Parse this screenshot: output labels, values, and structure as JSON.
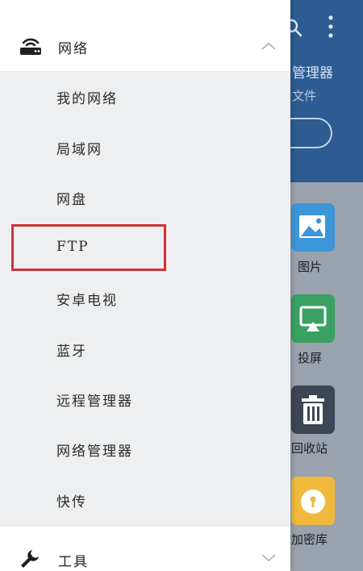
{
  "background": {
    "title": "管理器",
    "subtitle": "文件",
    "tiles": [
      {
        "label": "图片",
        "color": "#3d96d8",
        "icon": "image-icon"
      },
      {
        "label": "投屏",
        "color": "#3aa163",
        "icon": "cast-icon"
      },
      {
        "label": "回收站",
        "color": "#3d4656",
        "icon": "trash-icon"
      },
      {
        "label": "加密库",
        "color": "#f0b93b",
        "icon": "lock-icon"
      }
    ]
  },
  "drawer": {
    "network": {
      "label": "网络",
      "icon": "router-icon",
      "expanded": true
    },
    "items": [
      {
        "label": "我的网络"
      },
      {
        "label": "局域网"
      },
      {
        "label": "网盘"
      },
      {
        "label": "FTP"
      },
      {
        "label": "安卓电视"
      },
      {
        "label": "蓝牙"
      },
      {
        "label": "远程管理器"
      },
      {
        "label": "网络管理器"
      },
      {
        "label": "快传"
      }
    ],
    "tools": {
      "label": "工具",
      "icon": "wrench-icon",
      "expanded": false
    },
    "highlight_color": "#d13237"
  }
}
